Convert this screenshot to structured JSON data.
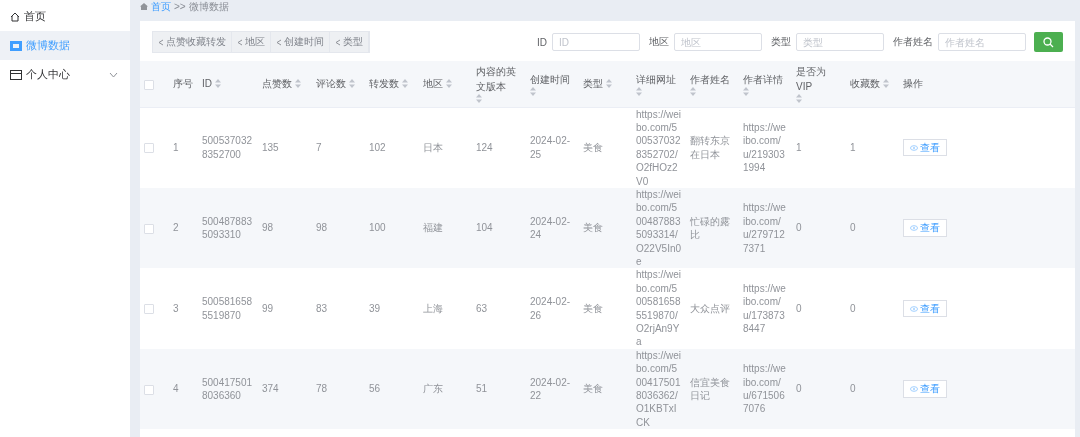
{
  "sidebar": {
    "items": [
      {
        "label": "首页",
        "selected": false
      },
      {
        "label": "微博数据",
        "selected": true
      },
      {
        "label": "个人中心",
        "selected": false,
        "expanded": false
      }
    ]
  },
  "breadcrumb": {
    "items": [
      "首页",
      "微博数据"
    ],
    "separator": ">>"
  },
  "chart_tabs": [
    {
      "label": "点赞收藏转发"
    },
    {
      "label": "地区"
    },
    {
      "label": "创建时间"
    },
    {
      "label": "类型"
    }
  ],
  "search": {
    "fields": [
      {
        "label": "ID",
        "placeholder": "ID"
      },
      {
        "label": "地区",
        "placeholder": "地区"
      },
      {
        "label": "类型",
        "placeholder": "类型"
      },
      {
        "label": "作者姓名",
        "placeholder": "作者姓名"
      }
    ]
  },
  "table": {
    "select_all": {
      "checked": false
    },
    "columns": [
      {
        "label": "序号",
        "sortable": false
      },
      {
        "label": "ID",
        "sortable": true
      },
      {
        "label": "点赞数",
        "sortable": true
      },
      {
        "label": "评论数",
        "sortable": true
      },
      {
        "label": "转发数",
        "sortable": true
      },
      {
        "label": "地区",
        "sortable": true
      },
      {
        "label": "内容的英文版本",
        "sortable": true
      },
      {
        "label": "创建时间",
        "sortable": true
      },
      {
        "label": "类型",
        "sortable": true
      },
      {
        "label": "详细网址",
        "sortable": true
      },
      {
        "label": "作者姓名",
        "sortable": true
      },
      {
        "label": "作者详情",
        "sortable": true
      },
      {
        "label": "是否为VIP",
        "sortable": true
      },
      {
        "label": "收藏数",
        "sortable": true
      },
      {
        "label": "操作",
        "sortable": false
      }
    ],
    "rows": [
      {
        "checked": false,
        "cells": [
          "1",
          "5005370328352700",
          "135",
          "7",
          "102",
          "日本",
          "124",
          "2024-02-25",
          "美食",
          "https://weibo.com/5005370328352702/O2fHOz2V0",
          "翻转东京在日本",
          "https://weibo.com/u/2193031994",
          "1",
          "1"
        ],
        "action": "查看"
      },
      {
        "checked": false,
        "cells": [
          "2",
          "5004878835093310",
          "98",
          "98",
          "100",
          "福建",
          "104",
          "2024-02-24",
          "美食",
          "https://weibo.com/5004878835093314/O22V5In0e",
          "忙碌的露比",
          "https://weibo.com/u/2797127371",
          "0",
          "0"
        ],
        "action": "查看"
      },
      {
        "checked": false,
        "cells": [
          "3",
          "5005816585519870",
          "99",
          "83",
          "39",
          "上海",
          "63",
          "2024-02-26",
          "美食",
          "https://weibo.com/5005816585519870/O2rjAn9Ya",
          "大众点评",
          "https://weibo.com/u/1738738447",
          "0",
          "0"
        ],
        "action": "查看"
      },
      {
        "checked": false,
        "cells": [
          "4",
          "5004175018036360",
          "374",
          "78",
          "56",
          "广东",
          "51",
          "2024-02-22",
          "美食",
          "https://weibo.com/5004175018036362/O1KBTxICK",
          "信宜美食日记",
          "https://weibo.com/u/6715067076",
          "0",
          "0"
        ],
        "action": "查看"
      }
    ]
  }
}
